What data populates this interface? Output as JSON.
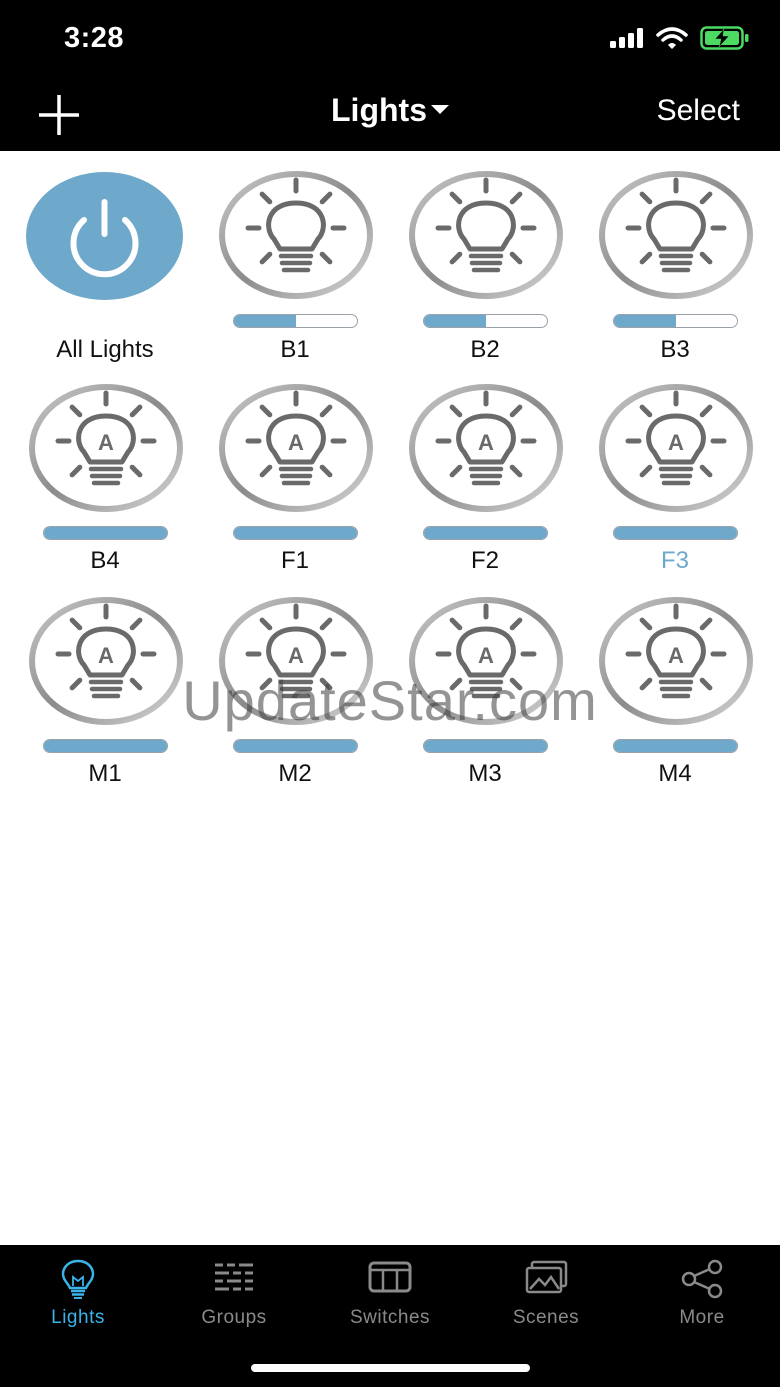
{
  "status": {
    "time": "3:28",
    "icons": [
      "signal-icon",
      "wifi-icon",
      "battery-charging-icon"
    ]
  },
  "nav": {
    "add_icon": "plus-icon",
    "title": "Lights",
    "title_icon": "caret-down-icon",
    "select_label": "Select"
  },
  "colors": {
    "accent": "#6ea9cb",
    "tab_active": "#3ab3e8",
    "bar": "#000000"
  },
  "all_lights": {
    "label": "All Lights",
    "icon": "power-icon"
  },
  "lights": [
    {
      "name": "B1",
      "icon": "bulb-icon",
      "level": 0.5,
      "selected": false
    },
    {
      "name": "B2",
      "icon": "bulb-icon",
      "level": 0.5,
      "selected": false
    },
    {
      "name": "B3",
      "icon": "bulb-icon",
      "level": 0.5,
      "selected": false
    },
    {
      "name": "B4",
      "icon": "auto-bulb-icon",
      "level": 1.0,
      "selected": false
    },
    {
      "name": "F1",
      "icon": "auto-bulb-icon",
      "level": 1.0,
      "selected": false
    },
    {
      "name": "F2",
      "icon": "auto-bulb-icon",
      "level": 1.0,
      "selected": false
    },
    {
      "name": "F3",
      "icon": "auto-bulb-icon",
      "level": 1.0,
      "selected": true
    },
    {
      "name": "M1",
      "icon": "auto-bulb-icon",
      "level": 1.0,
      "selected": false
    },
    {
      "name": "M2",
      "icon": "auto-bulb-icon",
      "level": 1.0,
      "selected": false
    },
    {
      "name": "M3",
      "icon": "auto-bulb-icon",
      "level": 1.0,
      "selected": false
    },
    {
      "name": "M4",
      "icon": "auto-bulb-icon",
      "level": 1.0,
      "selected": false
    }
  ],
  "watermark": "UpdateStar.com",
  "tabs": [
    {
      "label": "Lights",
      "icon": "lightbulb-icon",
      "active": true
    },
    {
      "label": "Groups",
      "icon": "groups-icon",
      "active": false
    },
    {
      "label": "Switches",
      "icon": "switches-icon",
      "active": false
    },
    {
      "label": "Scenes",
      "icon": "scenes-icon",
      "active": false
    },
    {
      "label": "More",
      "icon": "share-icon",
      "active": false
    }
  ]
}
